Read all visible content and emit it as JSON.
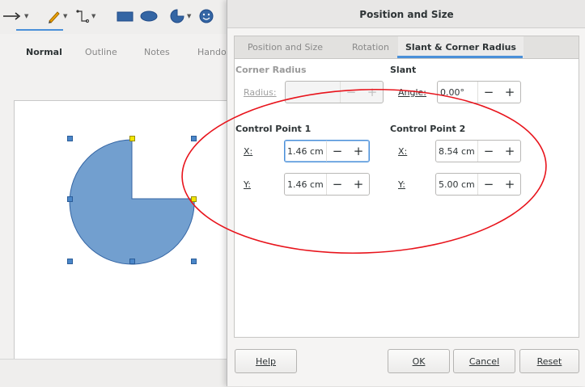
{
  "background_app": {
    "view_tabs": [
      "Normal",
      "Outline",
      "Notes",
      "Hando"
    ],
    "toolbar_icons": [
      "arrow-line-icon",
      "pencil-curve-icon",
      "connector-icon",
      "rectangle-icon",
      "ellipse-icon",
      "pie-shape-icon",
      "smiley-icon"
    ]
  },
  "dialog": {
    "title": "Position and Size",
    "tabs": [
      "Position and Size",
      "Rotation",
      "Slant & Corner Radius"
    ],
    "active_tab": "Slant & Corner Radius",
    "corner_radius": {
      "heading": "Corner Radius",
      "radius_label": "Radius:",
      "radius_value": ""
    },
    "slant": {
      "heading": "Slant",
      "angle_label": "Angle:",
      "angle_value": "0.00°"
    },
    "control_point_1": {
      "heading": "Control Point 1",
      "x_label": "X:",
      "x_value": "1.46 cm",
      "y_label": "Y:",
      "y_value": "1.46 cm"
    },
    "control_point_2": {
      "heading": "Control Point 2",
      "x_label": "X:",
      "x_value": "8.54 cm",
      "y_label": "Y:",
      "y_value": "5.00 cm"
    },
    "spin_minus": "−",
    "spin_plus": "+",
    "buttons": {
      "help": "Help",
      "ok": "OK",
      "cancel": "Cancel",
      "reset": "Reset"
    }
  },
  "colors": {
    "shape_fill": "#729fcf",
    "annotation": "#e8141c",
    "accent": "#4a90d9"
  }
}
